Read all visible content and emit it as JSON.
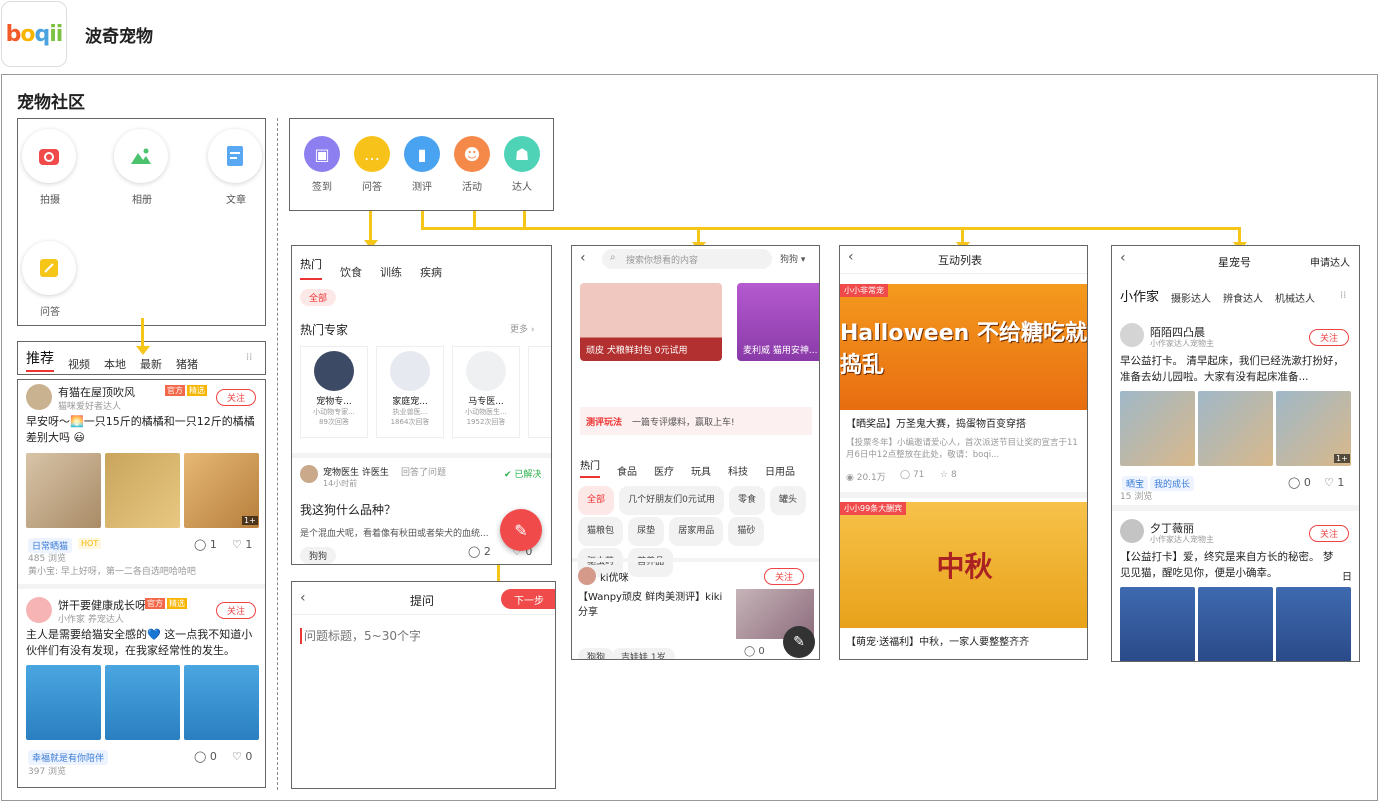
{
  "app": {
    "title": "波奇宠物"
  },
  "section": {
    "title": "宠物社区"
  },
  "publish": {
    "items": [
      {
        "label": "拍摄"
      },
      {
        "label": "相册"
      },
      {
        "label": "文章"
      },
      {
        "label": "问答"
      }
    ]
  },
  "feed": {
    "tabs": [
      "推荐",
      "视频",
      "本地",
      "最新",
      "猪猪"
    ],
    "posts": [
      {
        "user": "有猫在屋顶吹风",
        "badge1": "官方",
        "badge2": "精选",
        "sub": "猫咪爱好者达人",
        "follow": "关注",
        "text": "早安呀～🌅一只15斤的橘橘和一只12斤的橘橘差别大吗 😃",
        "tag": "日常晒猫",
        "tag_hot": "HOT",
        "comments": "1",
        "likes": "1",
        "views": "485 浏览",
        "reply": "黄小宝: 早上好呀，第一二各自选吧哈哈吧"
      },
      {
        "user": "饼干要健康成长呀",
        "badge1": "官方",
        "badge2": "精选",
        "sub": "小作家 养宠达人",
        "follow": "关注",
        "text": "主人是需要给猫安全感的💙 这一点我不知道小伙伴们有没有发现，在我家经常性的发生。",
        "tag": "幸福就是有你陪伴",
        "comments": "0",
        "likes": "0",
        "views": "397 浏览"
      }
    ],
    "more_count": "1+"
  },
  "categories": {
    "items": [
      {
        "label": "签到",
        "color": "#8d7ff0"
      },
      {
        "label": "问答",
        "color": "#f7c31a"
      },
      {
        "label": "测评",
        "color": "#4aa3f0"
      },
      {
        "label": "活动",
        "color": "#f5894a"
      },
      {
        "label": "达人",
        "color": "#4fd3b6"
      }
    ]
  },
  "qa": {
    "tabs": [
      "热门",
      "饮食",
      "训练",
      "疾病"
    ],
    "filter": "全部",
    "experts_title": "热门专家",
    "more": "更多",
    "experts": [
      {
        "name": "宠物专...",
        "sub": "小动物专家...",
        "count": "89次回答"
      },
      {
        "name": "家庭宠...",
        "sub": "执业兽医...",
        "count": "1864次回答"
      },
      {
        "name": "马专医...",
        "sub": "小动物医生...",
        "count": "1952次回答"
      }
    ],
    "answer_user": "宠物医生 许医生",
    "answer_meta": "回答了问题",
    "answer_time": "14小时前",
    "resolved": "已解决",
    "question": "我这狗什么品种？",
    "preview": "是个混血犬呢，看着像有秋田或者柴犬的血统...",
    "tag": "狗狗",
    "comments": "2",
    "likes": "0"
  },
  "ask": {
    "title": "提问",
    "next": "下一步",
    "placeholder": "问题标题，5~30个字"
  },
  "review": {
    "search_placeholder": "搜索你想看的内容",
    "category": "狗狗",
    "banner1": "顽皮 犬粮鲜封包 0元试用",
    "banner2": "麦利威 猫用安神...",
    "play_label": "测评玩法",
    "play_text": "一篇专评爆料，赢取上车!",
    "tabs": [
      "热门",
      "食品",
      "医疗",
      "玩具",
      "科技",
      "日用品"
    ],
    "pills": [
      "全部",
      "几个好朋友们0元试用",
      "零食",
      "罐头",
      "猫粮包",
      "尿垫",
      "居家用品",
      "猫砂",
      "驱虫药",
      "营养品"
    ],
    "user": "ki优咪",
    "follow": "关注",
    "post": "【Wanpy顽皮 鲜肉美测评】kiki分享",
    "tag1": "狗狗",
    "tag2": "吉娃娃 1岁",
    "comments": "0",
    "likes": "9"
  },
  "events": {
    "title": "互动列表",
    "badge1": "小小非常宠",
    "banner1_title": "Halloween 不给糖吃就捣乱",
    "item1_title": "【晒奖品】万圣鬼大赛，捣蛋物百变穿搭",
    "item1_desc": "【投票冬年】小编邀请爱心人，首次派送节目让奖的宣言于11月6日中12点整放在此处，敬请：boqi...",
    "item1_views": "20.1万",
    "item1_comments": "71",
    "item1_likes": "8",
    "badge2": "小小99条大酬宾",
    "banner2_title": "中秋",
    "item2_title": "【萌宠·送福利】中秋，一家人要整整齐齐"
  },
  "star": {
    "title": "星宠号",
    "apply": "申请达人",
    "tabs": [
      "小作家",
      "摄影达人",
      "辨食达人",
      "机械达人"
    ],
    "posts": [
      {
        "user": "陌陌四凸晨",
        "sub": "小作家达人宠物主",
        "follow": "关注",
        "text": "早公益打卡。 清早起床，我们已经洗漱打扮好，准备去幼儿园啦。大家有没有起床准备...",
        "tag1": "晒宝",
        "tag2": "我的成长",
        "comments": "0",
        "likes": "1",
        "views": "15 浏览"
      },
      {
        "user": "夕丁薇丽",
        "sub": "小作家达人宠物主",
        "follow": "关注",
        "text": "【公益打卡】爱，终究是来自方长的秘密。 梦见见猫，醒吃见你，便是小确幸。",
        "more": "日"
      }
    ],
    "more_count": "1+"
  }
}
